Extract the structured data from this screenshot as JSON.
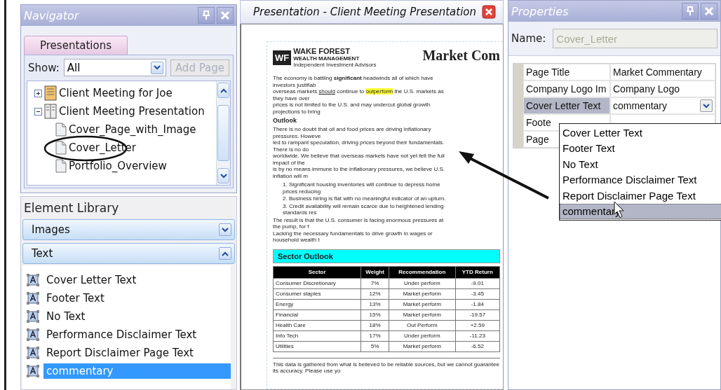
{
  "navigator": {
    "title": "Navigator",
    "tab": {
      "label": "Presentations",
      "selected": true
    },
    "show_label": "Show:",
    "show_value": "All",
    "add_page_button": {
      "label": "Add Page",
      "disabled": true
    },
    "tree": [
      {
        "label": "Client Meeting for Joe",
        "expanded": false
      },
      {
        "label": "Client Meeting Presentation",
        "expanded": true,
        "children": [
          {
            "label": "Cover_Page_with_Image"
          },
          {
            "label": "Cover_Letter"
          },
          {
            "label": "Portfolio_Overview"
          }
        ]
      }
    ]
  },
  "element_library": {
    "title": "Element Library",
    "sections": [
      {
        "label": "Images",
        "expanded": false
      },
      {
        "label": "Text",
        "expanded": true,
        "items": [
          {
            "label": "Cover Letter Text",
            "selected": false
          },
          {
            "label": "Footer Text",
            "selected": false
          },
          {
            "label": "No Text",
            "selected": false
          },
          {
            "label": "Performance Disclaimer Text",
            "selected": false
          },
          {
            "label": "Report Disclaimer Page Text",
            "selected": false
          },
          {
            "label": "commentary",
            "selected": true
          }
        ]
      }
    ]
  },
  "document": {
    "tab_title": "Presentation - Client Meeting Presentation",
    "logo": {
      "mark": "WF",
      "name": "WAKE FOREST",
      "subtitle": "WEALTH MANAGEMENT",
      "tagline": "Independent Investment Advisors"
    },
    "title": "Market Com",
    "intro": [
      [
        {
          "text": "The economy is battling ",
          "kind": "plain"
        },
        {
          "text": "significant",
          "kind": "bold"
        },
        {
          "text": " headwinds all of which have investors justifiab",
          "kind": "plain"
        }
      ],
      [
        {
          "text": "overseas markets ",
          "kind": "plain"
        },
        {
          "text": "should",
          "kind": "underline"
        },
        {
          "text": " continue to ",
          "kind": "plain"
        },
        {
          "text": "outperform",
          "kind": "highlight"
        },
        {
          "text": " the U.S. markets as they have over",
          "kind": "plain"
        }
      ],
      [
        {
          "text": "prices is not limited to the U.S. and may undercut global growth projections to bring",
          "kind": "plain"
        }
      ]
    ],
    "heading": "Outlook",
    "outlook": [
      "There is no doubt that oil and food prices are driving inflationary pressures. Howeve",
      "led to rampant speculation, driving prices beyond their fundamentals. There is no do",
      "worldwide. We believe that overseas markets have not yet felt the full impact of the",
      "is by no means immune to the inflationary pressures, we believe U.S. inflation will m"
    ],
    "points": [
      "1. Significant housing inventories will continue to depress home prices reducing",
      "2. Business hiring is flat with no meaningful indicator of an upturn.",
      "3. Credit availability will remain scarce due to heightened lending standards res"
    ],
    "result": [
      "The result is that the U.S. consumer is facing enormous pressures at the pump, for f",
      "Lacking the necessary fundamentals to drive growth in wages or household wealth t"
    ],
    "sector_heading": "Sector Outlook",
    "table": {
      "columns": [
        "Sector",
        "Weight",
        "Recommendation",
        "YTD Return"
      ],
      "rows": [
        [
          "Consumer Discretionary",
          "7%",
          "Under perform",
          "-9.01"
        ],
        [
          "Consumer staples",
          "12%",
          "Market perform",
          "-3.45"
        ],
        [
          "Energy",
          "13%",
          "Market perform",
          "-1.84"
        ],
        [
          "Financial",
          "15%",
          "Market perform",
          "-19.57"
        ],
        [
          "Health Care",
          "18%",
          "Out Perform",
          "+2.59"
        ],
        [
          "Info Tech",
          "17%",
          "Under perform",
          "-11.23"
        ],
        [
          "Utilities",
          "5%",
          "Market perform",
          "-6.52"
        ]
      ]
    },
    "footer": "This data is gathered from what is believed to be reliable sources, but we cannot guarantee its accuracy.  Please use yo"
  },
  "properties": {
    "title": "Properties",
    "name_label": "Name:",
    "name_value": "Cover_Letter",
    "rows": [
      {
        "name": "Page Title",
        "value": "Market Commentary",
        "selected": false,
        "kind": "text"
      },
      {
        "name": "Company Logo Im",
        "value": "Company Logo",
        "selected": false,
        "kind": "text"
      },
      {
        "name": "Cover Letter Text",
        "value": "commentary",
        "selected": true,
        "kind": "dropdown"
      },
      {
        "name": "Foote",
        "selected": false,
        "kind": "text"
      },
      {
        "name": "Page",
        "selected": false,
        "kind": "text"
      }
    ],
    "dropdown_options": [
      {
        "label": "Cover Letter Text",
        "selected": false
      },
      {
        "label": "Footer Text",
        "selected": false
      },
      {
        "label": "No Text",
        "selected": false
      },
      {
        "label": "Performance Disclaimer Text",
        "selected": false
      },
      {
        "label": "Report Disclaimer Page Text",
        "selected": false
      },
      {
        "label": "commentary",
        "selected": true
      }
    ]
  }
}
